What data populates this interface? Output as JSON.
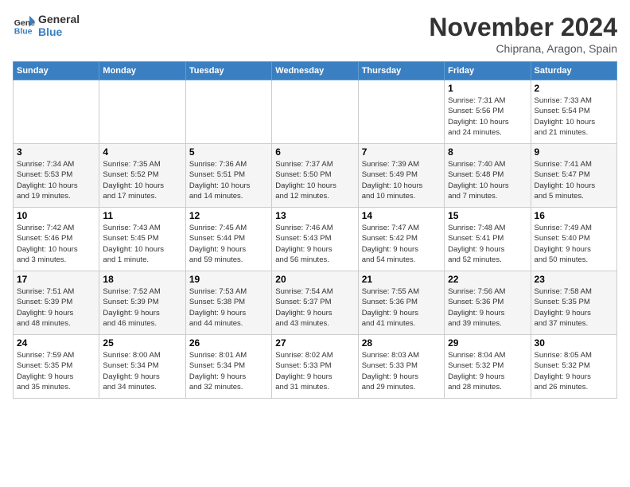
{
  "header": {
    "logo_line1": "General",
    "logo_line2": "Blue",
    "month": "November 2024",
    "location": "Chiprana, Aragon, Spain"
  },
  "weekdays": [
    "Sunday",
    "Monday",
    "Tuesday",
    "Wednesday",
    "Thursday",
    "Friday",
    "Saturday"
  ],
  "weeks": [
    [
      {
        "day": "",
        "info": ""
      },
      {
        "day": "",
        "info": ""
      },
      {
        "day": "",
        "info": ""
      },
      {
        "day": "",
        "info": ""
      },
      {
        "day": "",
        "info": ""
      },
      {
        "day": "1",
        "info": "Sunrise: 7:31 AM\nSunset: 5:56 PM\nDaylight: 10 hours\nand 24 minutes."
      },
      {
        "day": "2",
        "info": "Sunrise: 7:33 AM\nSunset: 5:54 PM\nDaylight: 10 hours\nand 21 minutes."
      }
    ],
    [
      {
        "day": "3",
        "info": "Sunrise: 7:34 AM\nSunset: 5:53 PM\nDaylight: 10 hours\nand 19 minutes."
      },
      {
        "day": "4",
        "info": "Sunrise: 7:35 AM\nSunset: 5:52 PM\nDaylight: 10 hours\nand 17 minutes."
      },
      {
        "day": "5",
        "info": "Sunrise: 7:36 AM\nSunset: 5:51 PM\nDaylight: 10 hours\nand 14 minutes."
      },
      {
        "day": "6",
        "info": "Sunrise: 7:37 AM\nSunset: 5:50 PM\nDaylight: 10 hours\nand 12 minutes."
      },
      {
        "day": "7",
        "info": "Sunrise: 7:39 AM\nSunset: 5:49 PM\nDaylight: 10 hours\nand 10 minutes."
      },
      {
        "day": "8",
        "info": "Sunrise: 7:40 AM\nSunset: 5:48 PM\nDaylight: 10 hours\nand 7 minutes."
      },
      {
        "day": "9",
        "info": "Sunrise: 7:41 AM\nSunset: 5:47 PM\nDaylight: 10 hours\nand 5 minutes."
      }
    ],
    [
      {
        "day": "10",
        "info": "Sunrise: 7:42 AM\nSunset: 5:46 PM\nDaylight: 10 hours\nand 3 minutes."
      },
      {
        "day": "11",
        "info": "Sunrise: 7:43 AM\nSunset: 5:45 PM\nDaylight: 10 hours\nand 1 minute."
      },
      {
        "day": "12",
        "info": "Sunrise: 7:45 AM\nSunset: 5:44 PM\nDaylight: 9 hours\nand 59 minutes."
      },
      {
        "day": "13",
        "info": "Sunrise: 7:46 AM\nSunset: 5:43 PM\nDaylight: 9 hours\nand 56 minutes."
      },
      {
        "day": "14",
        "info": "Sunrise: 7:47 AM\nSunset: 5:42 PM\nDaylight: 9 hours\nand 54 minutes."
      },
      {
        "day": "15",
        "info": "Sunrise: 7:48 AM\nSunset: 5:41 PM\nDaylight: 9 hours\nand 52 minutes."
      },
      {
        "day": "16",
        "info": "Sunrise: 7:49 AM\nSunset: 5:40 PM\nDaylight: 9 hours\nand 50 minutes."
      }
    ],
    [
      {
        "day": "17",
        "info": "Sunrise: 7:51 AM\nSunset: 5:39 PM\nDaylight: 9 hours\nand 48 minutes."
      },
      {
        "day": "18",
        "info": "Sunrise: 7:52 AM\nSunset: 5:39 PM\nDaylight: 9 hours\nand 46 minutes."
      },
      {
        "day": "19",
        "info": "Sunrise: 7:53 AM\nSunset: 5:38 PM\nDaylight: 9 hours\nand 44 minutes."
      },
      {
        "day": "20",
        "info": "Sunrise: 7:54 AM\nSunset: 5:37 PM\nDaylight: 9 hours\nand 43 minutes."
      },
      {
        "day": "21",
        "info": "Sunrise: 7:55 AM\nSunset: 5:36 PM\nDaylight: 9 hours\nand 41 minutes."
      },
      {
        "day": "22",
        "info": "Sunrise: 7:56 AM\nSunset: 5:36 PM\nDaylight: 9 hours\nand 39 minutes."
      },
      {
        "day": "23",
        "info": "Sunrise: 7:58 AM\nSunset: 5:35 PM\nDaylight: 9 hours\nand 37 minutes."
      }
    ],
    [
      {
        "day": "24",
        "info": "Sunrise: 7:59 AM\nSunset: 5:35 PM\nDaylight: 9 hours\nand 35 minutes."
      },
      {
        "day": "25",
        "info": "Sunrise: 8:00 AM\nSunset: 5:34 PM\nDaylight: 9 hours\nand 34 minutes."
      },
      {
        "day": "26",
        "info": "Sunrise: 8:01 AM\nSunset: 5:34 PM\nDaylight: 9 hours\nand 32 minutes."
      },
      {
        "day": "27",
        "info": "Sunrise: 8:02 AM\nSunset: 5:33 PM\nDaylight: 9 hours\nand 31 minutes."
      },
      {
        "day": "28",
        "info": "Sunrise: 8:03 AM\nSunset: 5:33 PM\nDaylight: 9 hours\nand 29 minutes."
      },
      {
        "day": "29",
        "info": "Sunrise: 8:04 AM\nSunset: 5:32 PM\nDaylight: 9 hours\nand 28 minutes."
      },
      {
        "day": "30",
        "info": "Sunrise: 8:05 AM\nSunset: 5:32 PM\nDaylight: 9 hours\nand 26 minutes."
      }
    ]
  ]
}
